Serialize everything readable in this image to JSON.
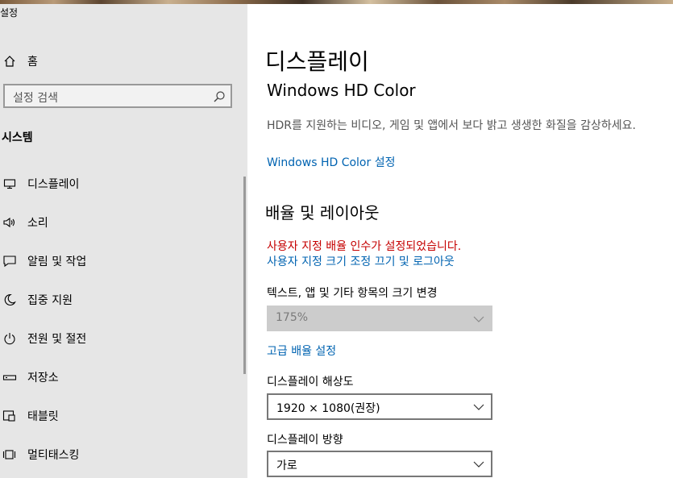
{
  "app": {
    "title": "설정"
  },
  "sidebar": {
    "home_label": "홈",
    "search_placeholder": "설정 검색",
    "section_title": "시스템",
    "items": [
      {
        "label": "디스플레이",
        "icon": "monitor-icon"
      },
      {
        "label": "소리",
        "icon": "speaker-icon"
      },
      {
        "label": "알림 및 작업",
        "icon": "message-icon"
      },
      {
        "label": "집중 지원",
        "icon": "moon-icon"
      },
      {
        "label": "전원 및 절전",
        "icon": "power-icon"
      },
      {
        "label": "저장소",
        "icon": "storage-icon"
      },
      {
        "label": "태블릿",
        "icon": "tablet-icon"
      },
      {
        "label": "멀티태스킹",
        "icon": "multitasking-icon"
      }
    ]
  },
  "main": {
    "page_title": "디스플레이",
    "hdr": {
      "title": "Windows HD Color",
      "description": "HDR를 지원하는 비디오, 게임 및 앱에서 보다 밝고 생생한 화질을 감상하세요.",
      "link": "Windows HD Color 설정"
    },
    "scale": {
      "title": "배율 및 레이아웃",
      "warning": "사용자 지정 배율 인수가 설정되었습니다.",
      "signout_link": "사용자 지정 크기 조정 끄기 및 로그아웃",
      "size_label": "텍스트, 앱 및 기타 항목의 크기 변경",
      "size_value": "175%",
      "advanced_link": "고급 배율 설정",
      "resolution_label": "디스플레이 해상도",
      "resolution_value": "1920 × 1080(권장)",
      "orientation_label": "디스플레이 방향",
      "orientation_value": "가로"
    }
  }
}
